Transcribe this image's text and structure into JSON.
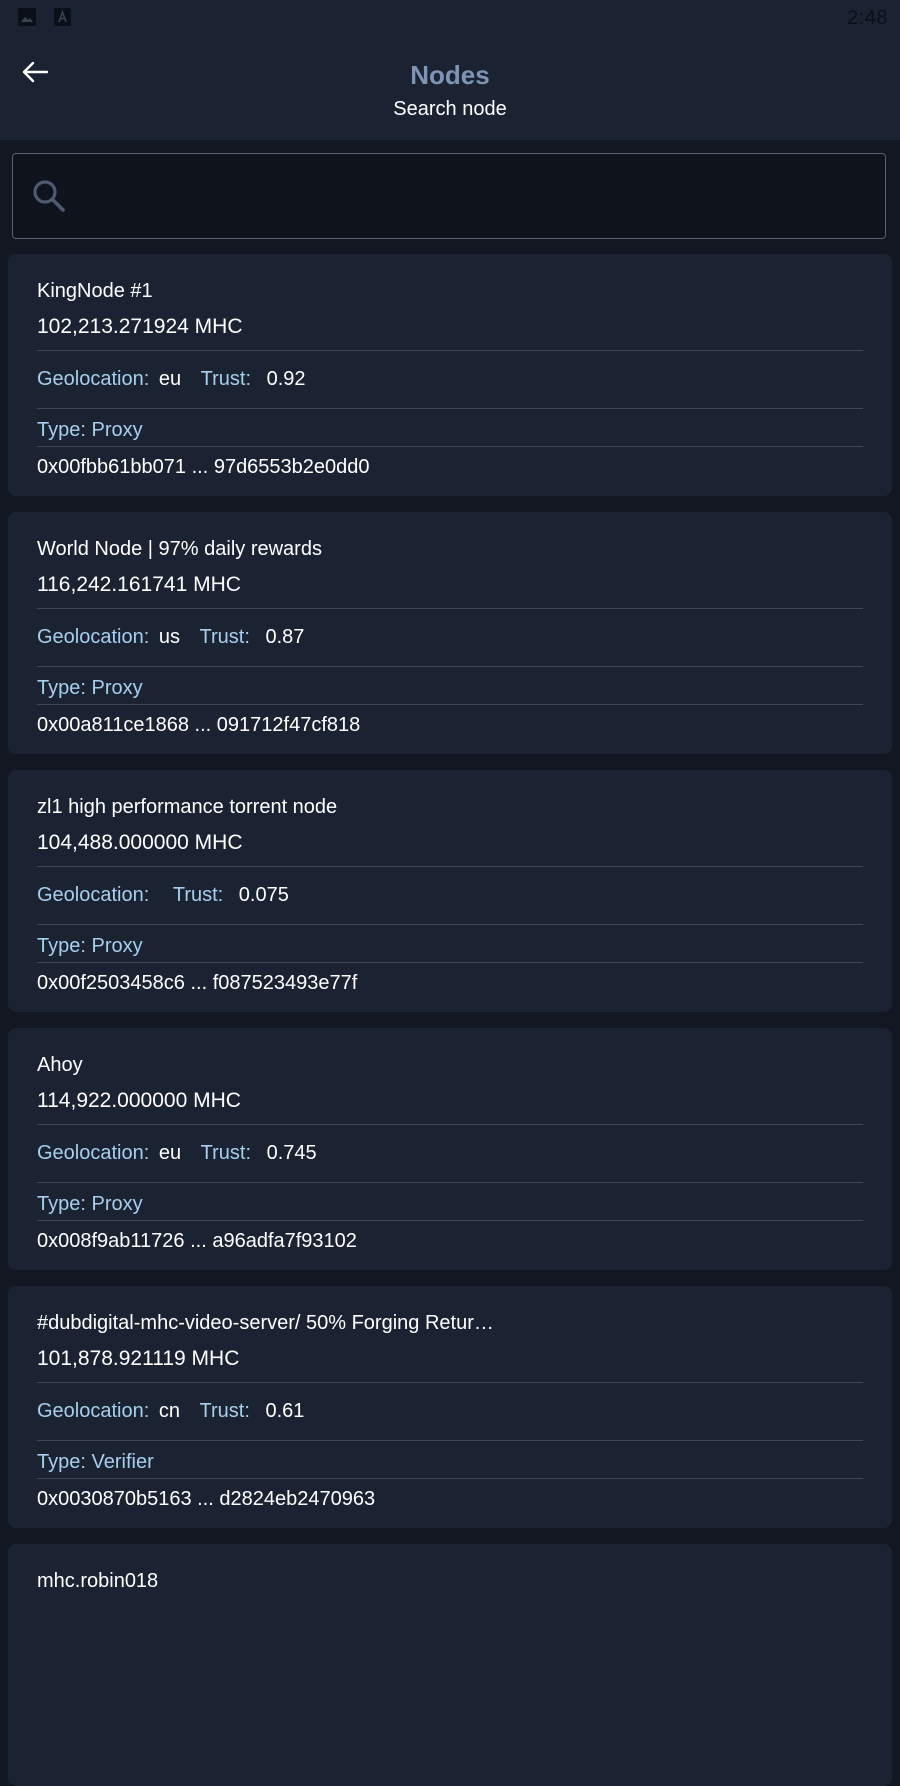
{
  "status_bar": {
    "time": "2:48",
    "icons": [
      "image-icon",
      "text-icon"
    ]
  },
  "header": {
    "title": "Nodes",
    "subtitle": "Search node",
    "back_icon": "arrow-left-icon"
  },
  "search": {
    "placeholder": "",
    "value": "",
    "icon": "search-icon"
  },
  "labels": {
    "geolocation": "Geolocation:",
    "trust": "Trust:",
    "type": "Type:"
  },
  "colors": {
    "accent_label": "#a6cfee",
    "title": "#7e94b4",
    "card_bg": "#1b2333",
    "page_bg": "#121722"
  },
  "nodes": [
    {
      "name": "KingNode #1",
      "balance": "102,213.271924 MHC",
      "geolocation": "eu",
      "trust": "0.92",
      "type": "Proxy",
      "address": "0x00fbb61bb071 ... 97d6553b2e0dd0"
    },
    {
      "name": "World Node | 97% daily rewards",
      "balance": "116,242.161741 MHC",
      "geolocation": "us",
      "trust": "0.87",
      "type": "Proxy",
      "address": "0x00a811ce1868 ... 091712f47cf818"
    },
    {
      "name": "zl1 high performance torrent node",
      "balance": "104,488.000000 MHC",
      "geolocation": "",
      "trust": "0.075",
      "type": "Proxy",
      "address": "0x00f2503458c6 ... f087523493e77f"
    },
    {
      "name": "Ahoy",
      "balance": "114,922.000000 MHC",
      "geolocation": "eu",
      "trust": "0.745",
      "type": "Proxy",
      "address": "0x008f9ab11726 ... a96adfa7f93102"
    },
    {
      "name": "#dubdigital-mhc-video-server/ 50% Forging Retur…",
      "balance": "101,878.921119 MHC",
      "geolocation": "cn",
      "trust": "0.61",
      "type": "Verifier",
      "address": "0x0030870b5163 ... d2824eb2470963"
    },
    {
      "name": "mhc.robin018",
      "balance": "",
      "geolocation": "",
      "trust": "",
      "type": "",
      "address": ""
    }
  ]
}
